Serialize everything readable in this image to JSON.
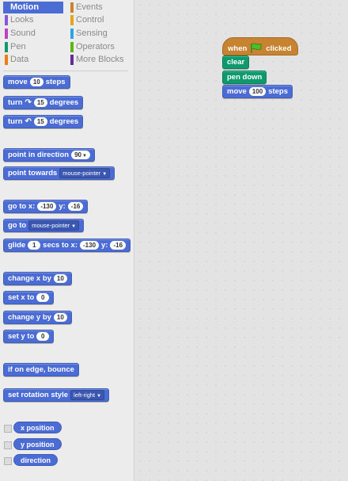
{
  "categories": {
    "left": [
      {
        "label": "Motion",
        "color": "#4a6cd4",
        "selected": true
      },
      {
        "label": "Looks",
        "color": "#8a55d7"
      },
      {
        "label": "Sound",
        "color": "#bb42c3"
      },
      {
        "label": "Pen",
        "color": "#0e9a6c"
      },
      {
        "label": "Data",
        "color": "#ee7d16"
      }
    ],
    "right": [
      {
        "label": "Events",
        "color": "#c88330"
      },
      {
        "label": "Control",
        "color": "#e1a91a"
      },
      {
        "label": "Sensing",
        "color": "#2ca5e2"
      },
      {
        "label": "Operators",
        "color": "#5cb712"
      },
      {
        "label": "More Blocks",
        "color": "#632d99"
      }
    ]
  },
  "palette": {
    "move": {
      "a": "move",
      "v": "10",
      "b": "steps"
    },
    "turn_right": {
      "a": "turn",
      "v": "15",
      "b": "degrees"
    },
    "turn_left": {
      "a": "turn",
      "v": "15",
      "b": "degrees"
    },
    "point_dir": {
      "a": "point in direction",
      "v": "90"
    },
    "point_towards": {
      "a": "point towards",
      "v": "mouse-pointer"
    },
    "goto_xy": {
      "a": "go to x:",
      "x": "-130",
      "b": "y:",
      "y": "-16"
    },
    "goto": {
      "a": "go to",
      "v": "mouse-pointer"
    },
    "glide": {
      "a": "glide",
      "v": "1",
      "b": "secs to x:",
      "x": "-130",
      "c": "y:",
      "y": "-16"
    },
    "change_x": {
      "a": "change x by",
      "v": "10"
    },
    "set_x": {
      "a": "set x to",
      "v": "0"
    },
    "change_y": {
      "a": "change y by",
      "v": "10"
    },
    "set_y": {
      "a": "set y to",
      "v": "0"
    },
    "bounce": {
      "a": "if on edge, bounce"
    },
    "rot_style": {
      "a": "set rotation style",
      "v": "left-right"
    },
    "reporters": [
      "x position",
      "y position",
      "direction"
    ]
  },
  "script": {
    "hat": {
      "a": "when",
      "b": "clicked"
    },
    "clear": "clear",
    "pen_down": "pen down",
    "move": {
      "a": "move",
      "v": "100",
      "b": "steps"
    }
  }
}
